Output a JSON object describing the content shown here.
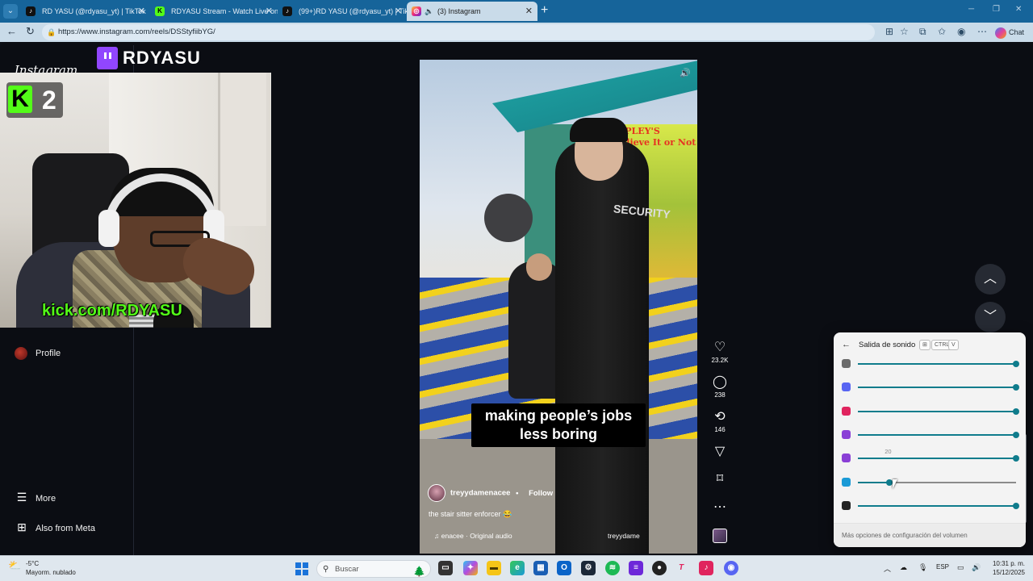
{
  "browser": {
    "tabs": [
      {
        "label": "RD YASU (@rdyasu_yt) | TikTok",
        "active": false
      },
      {
        "label": "RDYASU Stream - Watch Live on K",
        "active": false
      },
      {
        "label": "(99+)RD YASU (@rdyasu_yt) | TikTok",
        "active": false
      },
      {
        "label": "(3) Instagram",
        "active": true
      }
    ],
    "url": "https://www.instagram.com/reels/DSStyfiibYG/",
    "chat_label": "Chat"
  },
  "instagram": {
    "logo": "Instagram",
    "sidebar": {
      "profile": "Profile",
      "more": "More",
      "also_from_meta": "Also from Meta"
    },
    "reel": {
      "caption_line1": "making people’s jobs",
      "caption_line2": "less boring",
      "username": "treyydamenacee",
      "follow": "Follow",
      "description": "the stair sitter enforcer 😂",
      "audio": "enacee · Original audio",
      "audio_right": "treyydame"
    },
    "actions": {
      "likes": "23.2K",
      "comments": "238",
      "reposts": "146"
    }
  },
  "overlay": {
    "twitch_name": "RDYASU",
    "kick_badge_number": "2",
    "kick_url": "kick.com/RDYASU"
  },
  "volume_panel": {
    "title": "Salida de sonido",
    "shortcut_ctrl": "CTRL",
    "shortcut_v": "V",
    "tooltip": "20",
    "footer": "Más opciones de configuración del volumen",
    "apps": [
      {
        "icon": "notepad-icon",
        "color": "#6b6b6b",
        "level": 1.0
      },
      {
        "icon": "discord-icon",
        "color": "#5865f2",
        "level": 1.0
      },
      {
        "icon": "tiktok-icon",
        "color": "#e0245e",
        "level": 1.0
      },
      {
        "icon": "app-icon",
        "color": "#8a3fd6",
        "level": 1.0
      },
      {
        "icon": "app-icon-2",
        "color": "#8a3fd6",
        "level": 1.0
      },
      {
        "icon": "edge-icon",
        "color": "#1a9ad6",
        "level": 0.2
      },
      {
        "icon": "obs-icon",
        "color": "#222222",
        "level": 1.0
      }
    ]
  },
  "taskbar": {
    "temperature": "-5°C",
    "weather": "Mayorm. nublado",
    "search_placeholder": "Buscar",
    "language": "ESP",
    "time": "10:31 p. m.",
    "date": "15/12/2025"
  }
}
